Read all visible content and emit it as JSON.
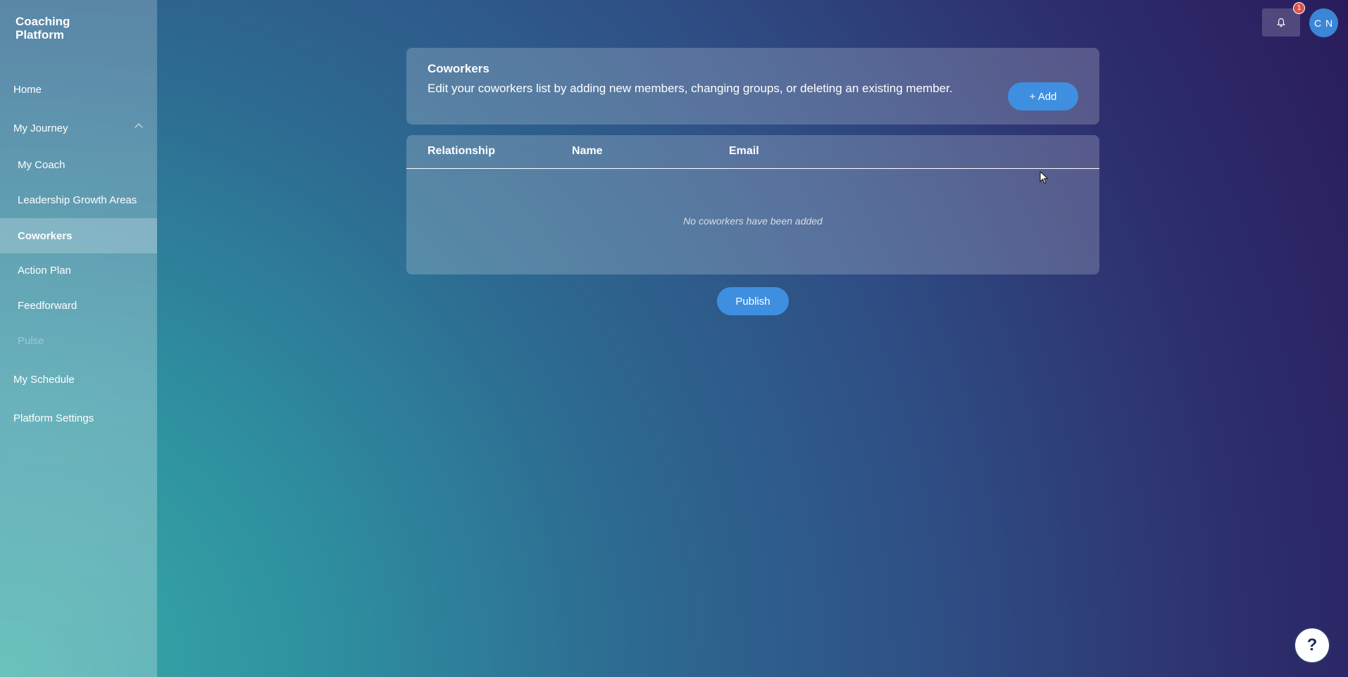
{
  "brand": {
    "line1": "Coaching",
    "line2": "Platform"
  },
  "sidebar": {
    "items": [
      {
        "label": "Home"
      },
      {
        "label": "My Journey"
      },
      {
        "label": "My Coach"
      },
      {
        "label": "Leadership Growth Areas"
      },
      {
        "label": "Coworkers"
      },
      {
        "label": "Action Plan"
      },
      {
        "label": "Feedforward"
      },
      {
        "label": "Pulse"
      },
      {
        "label": "My Schedule"
      },
      {
        "label": "Platform Settings"
      }
    ],
    "active_item": "Coworkers",
    "disabled_item": "Pulse"
  },
  "topbar": {
    "notification_count": "1",
    "avatar_initials": "C N"
  },
  "coworkers": {
    "title": "Coworkers",
    "description": "Edit your coworkers list by adding new members, changing groups, or deleting an existing member.",
    "add_label": "+ Add"
  },
  "table": {
    "columns": [
      "Relationship",
      "Name",
      "Email"
    ],
    "rows": [],
    "empty_message": "No coworkers have been added"
  },
  "publish_label": "Publish",
  "help_label": "?",
  "colors": {
    "accent": "#3f8fe0",
    "badge": "#d9534f",
    "avatar": "#3b86d6"
  }
}
